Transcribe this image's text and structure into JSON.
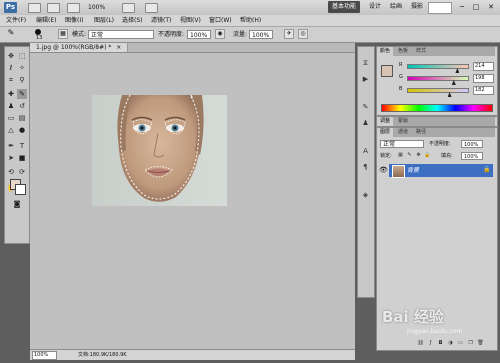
{
  "app_bar": {
    "logo": "Ps",
    "zoom": "100%",
    "workspaces": [
      "基本功能",
      "设计",
      "绘画",
      "摄影"
    ],
    "more": "»",
    "window_controls": [
      "─",
      "□",
      "✕"
    ]
  },
  "menu": {
    "items": [
      "文件(F)",
      "编辑(E)",
      "图像(I)",
      "图层(L)",
      "选择(S)",
      "滤镜(T)",
      "视图(V)",
      "窗口(W)",
      "帮助(H)"
    ]
  },
  "options": {
    "brush_size": "13",
    "mode_label": "模式:",
    "mode_value": "正常",
    "opacity_label": "不透明度:",
    "opacity_value": "100%",
    "flow_label": "流量:",
    "flow_value": "100%"
  },
  "document": {
    "tab_title": "1.jpg @ 100%(RGB/8#) *",
    "close": "×"
  },
  "status": {
    "zoom": "100%",
    "doc_info": "文档:180.9K/180.9K"
  },
  "color_panel": {
    "tabs": [
      "颜色",
      "色板",
      "样式"
    ],
    "channels": [
      {
        "label": "R",
        "value": "214",
        "fraction": 0.84
      },
      {
        "label": "G",
        "value": "198",
        "fraction": 0.78
      },
      {
        "label": "B",
        "value": "182",
        "fraction": 0.71
      }
    ]
  },
  "adjust_panel": {
    "tabs": [
      "调整",
      "蒙版"
    ]
  },
  "layers_panel": {
    "tabs": [
      "图层",
      "通道",
      "路径"
    ],
    "blend_mode": "正常",
    "opacity_label": "不透明度:",
    "opacity_value": "100%",
    "lock_label": "锁定:",
    "fill_label": "填充:",
    "fill_value": "100%",
    "layer_name": "背景"
  },
  "watermark": {
    "brand": "Bai 经验",
    "url": "jingyan.baidu.com"
  },
  "colors": {
    "foreground": "#e9d8c9",
    "layer_selected": "#3c6fc2",
    "skin": "#c8a78b"
  },
  "icons": {
    "tools": [
      "move-icon",
      "marquee-icon",
      "lasso-icon",
      "quick-select-icon",
      "crop-icon",
      "eyedropper-icon",
      "healing-icon",
      "brush-icon",
      "clone-stamp-icon",
      "history-brush-icon",
      "eraser-icon",
      "gradient-icon",
      "blur-icon",
      "dodge-icon",
      "pen-icon",
      "type-icon",
      "path-select-icon",
      "shape-icon",
      "3d-rotate-icon",
      "3d-orbit-icon",
      "hand-icon",
      "zoom-icon"
    ]
  }
}
